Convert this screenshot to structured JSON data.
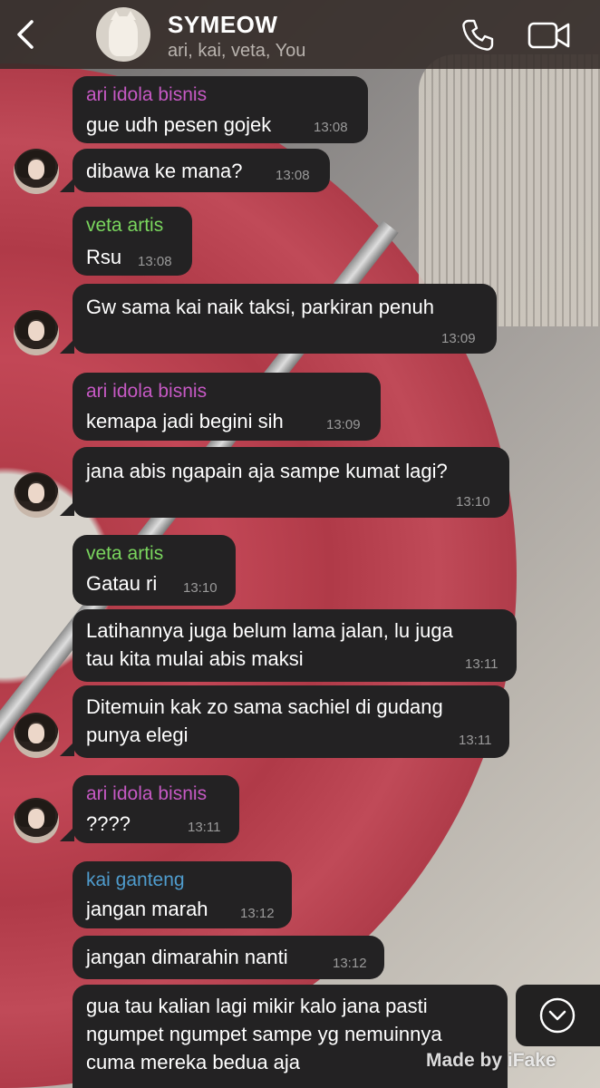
{
  "header": {
    "title": "SYMEOW",
    "subtitle": "ari, kai, veta, You",
    "avatar_text": "SYMEOW"
  },
  "colors": {
    "ari": "#c659c4",
    "veta": "#7ad65e",
    "kai": "#4f9ccd",
    "bubble": "#232223",
    "time": "#9a9a9a"
  },
  "messages": [
    {
      "sender": "ari idola bisnis",
      "text": "gue udh pesen gojek",
      "time": "13:08"
    },
    {
      "sender": "",
      "text": "dibawa ke mana?",
      "time": "13:08"
    },
    {
      "sender": "veta artis",
      "text": "Rsu",
      "time": "13:08"
    },
    {
      "sender": "",
      "text": "Gw sama kai naik taksi, parkiran penuh",
      "time": "13:09"
    },
    {
      "sender": "ari idola bisnis",
      "text": "kemapa jadi begini sih",
      "time": "13:09"
    },
    {
      "sender": "",
      "text": "jana abis ngapain aja sampe kumat lagi?",
      "time": "13:10"
    },
    {
      "sender": "veta artis",
      "text": "Gatau ri",
      "time": "13:10"
    },
    {
      "sender": "",
      "text": "Latihannya juga belum lama jalan, lu juga\ntau kita mulai abis maksi",
      "time": "13:11"
    },
    {
      "sender": "",
      "text": "Ditemuin kak zo sama sachiel di gudang\npunya elegi",
      "time": "13:11"
    },
    {
      "sender": "ari idola bisnis",
      "text": "????",
      "time": "13:11"
    },
    {
      "sender": "kai ganteng",
      "text": "jangan marah",
      "time": "13:12"
    },
    {
      "sender": "",
      "text": "jangan dimarahin nanti",
      "time": "13:12"
    },
    {
      "sender": "",
      "text": "gua tau kalian lagi mikir kalo jana pasti\nngumpet ngumpet sampe yg nemuinnya\ncuma mereka bedua aja",
      "time": ""
    }
  ],
  "watermark": "Made by iFake"
}
